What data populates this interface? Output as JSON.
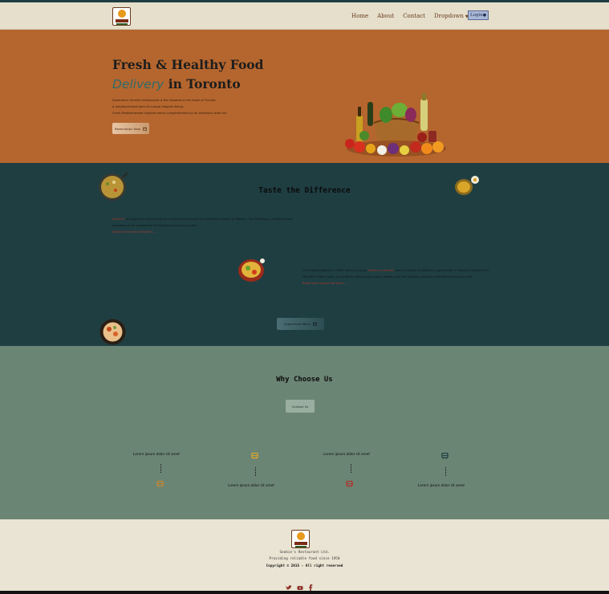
{
  "nav": {
    "links": [
      "Home",
      "About",
      "Contact",
      "Dropdown"
    ],
    "login_label": "Login"
  },
  "hero": {
    "title_line1": "Fresh & Healthy Food",
    "title_accent": "Delivery",
    "title_rest": " in Toronto",
    "description_lines": [
      "Experience Seokie's Restaurant & Bar situated in the heart of Toronto.",
      "A neighbourhood gem for casual elegant dining.",
      "Fresh Mediterranean inspired menu complemented by an extensive wine list."
    ],
    "cta_label": "Reservation Now"
  },
  "taste": {
    "title": "Taste the Difference",
    "p1_highlight": "Seokie's",
    "p1_text": " brought the whole world to create food proudly and distinctly Seokie in Mexico. The traditions, creativity and passions of our people are formalised behind each dish",
    "p1_link": "Read more about Seokie's ...",
    "p2_pre": "The legend begins in 1950, when a young ",
    "p2_highlight": "Seokie Lorenzetti",
    "p2_text": " took a chance to different opportunity in Mexico's production. He didn't have much, but what he did possess was a dream and the singular devotion needed to bring it to life.",
    "p2_link": "Read more about the story ...",
    "button_label": "Experience Menu"
  },
  "why": {
    "title": "Why Choose Us",
    "button_label": "Contact Us",
    "timeline_label": "Lorem ipsum dolor sit amet"
  },
  "footer": {
    "line1": "Seokie's Restaurant Ltd.",
    "line2": "Providing reliable food since 1950",
    "copyright": "Copyright © 2015 - All right reserved"
  },
  "colors": {
    "hero_bg": "#b5662e",
    "taste_bg": "#1f3e42",
    "why_bg": "#6b8574",
    "footer_bg": "#e9e4d3",
    "accent_teal": "#2d6a6a",
    "accent_red": "#a8322a"
  },
  "icons": [
    "bus-icon",
    "calendar-icon",
    "twitter-icon",
    "youtube-icon",
    "facebook-icon",
    "user-icon"
  ]
}
